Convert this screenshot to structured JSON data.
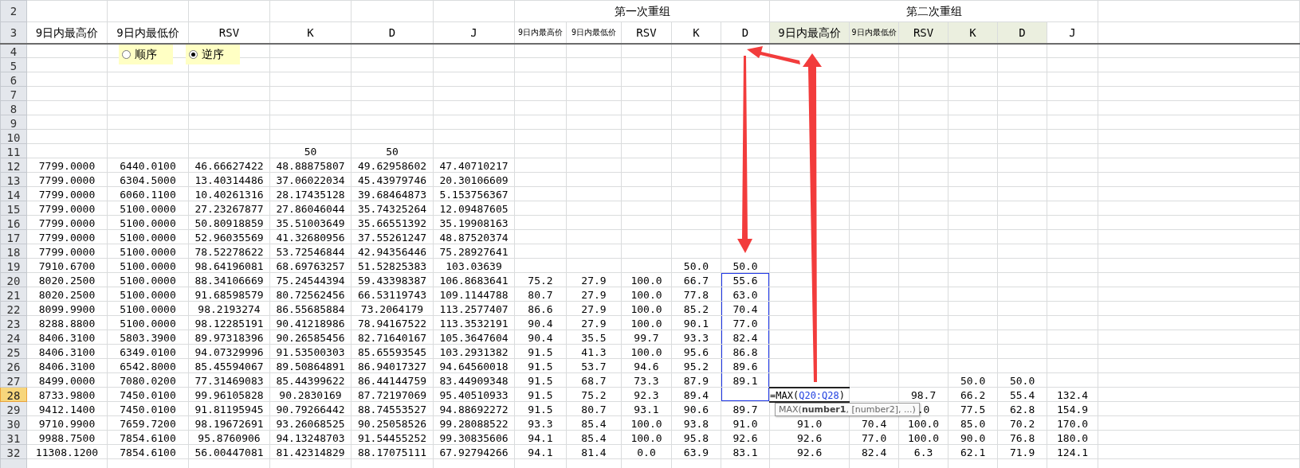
{
  "title_row": {
    "row": "2",
    "groups": [
      {
        "title": "第一次重组"
      },
      {
        "title": "第二次重组"
      }
    ]
  },
  "heading_row": {
    "row": "3",
    "columns": [
      {
        "label": "9日内最高价",
        "highlighted": false
      },
      {
        "label": "9日内最低价",
        "highlighted": false
      },
      {
        "label": "RSV",
        "highlighted": false
      },
      {
        "label": "K",
        "highlighted": false
      },
      {
        "label": "D",
        "highlighted": false
      },
      {
        "label": "J",
        "highlighted": false
      },
      {
        "label": "9日内最高价",
        "highlighted": false
      },
      {
        "label": "9日内最低价",
        "highlighted": false
      },
      {
        "label": "RSV",
        "highlighted": false
      },
      {
        "label": "K",
        "highlighted": false
      },
      {
        "label": "D",
        "highlighted": false
      },
      {
        "label": "9日内最高价",
        "highlighted": true
      },
      {
        "label": "9日内最低价",
        "highlighted": true
      },
      {
        "label": "RSV",
        "highlighted": true
      },
      {
        "label": "K",
        "highlighted": true
      },
      {
        "label": "D",
        "highlighted": true
      },
      {
        "label": "J",
        "highlighted": false
      }
    ]
  },
  "order_options": [
    {
      "label": "顺序",
      "selected": false
    },
    {
      "label": "逆序",
      "selected": true
    }
  ],
  "rows": [
    {
      "row": "4",
      "selected": false,
      "referenced": false
    },
    {
      "row": "5",
      "selected": false,
      "referenced": false
    },
    {
      "row": "6",
      "selected": false,
      "referenced": false
    },
    {
      "row": "7",
      "selected": false,
      "referenced": false
    },
    {
      "row": "8",
      "selected": false,
      "referenced": false
    },
    {
      "row": "9",
      "selected": false,
      "referenced": false
    },
    {
      "row": "10",
      "selected": false,
      "referenced": false
    },
    {
      "row": "11",
      "selected": false,
      "referenced": false,
      "cells": [
        null,
        null,
        null,
        "50",
        "50",
        null,
        null,
        null,
        null,
        null,
        null,
        null,
        null,
        null,
        null,
        null,
        null
      ]
    },
    {
      "row": "12",
      "selected": false,
      "referenced": false,
      "cells": [
        "7799.0000",
        "6440.0100",
        "46.66627422",
        "48.88875807",
        "49.62958602",
        "47.40710217",
        null,
        null,
        null,
        null,
        null,
        null,
        null,
        null,
        null,
        null,
        null
      ]
    },
    {
      "row": "13",
      "selected": false,
      "referenced": false,
      "cells": [
        "7799.0000",
        "6304.5000",
        "13.40314486",
        "37.06022034",
        "45.43979746",
        "20.30106609",
        null,
        null,
        null,
        null,
        null,
        null,
        null,
        null,
        null,
        null,
        null
      ]
    },
    {
      "row": "14",
      "selected": false,
      "referenced": false,
      "cells": [
        "7799.0000",
        "6060.1100",
        "10.40261316",
        "28.17435128",
        "39.68464873",
        "5.153756367",
        null,
        null,
        null,
        null,
        null,
        null,
        null,
        null,
        null,
        null,
        null
      ]
    },
    {
      "row": "15",
      "selected": false,
      "referenced": false,
      "cells": [
        "7799.0000",
        "5100.0000",
        "27.23267877",
        "27.86046044",
        "35.74325264",
        "12.09487605",
        null,
        null,
        null,
        null,
        null,
        null,
        null,
        null,
        null,
        null,
        null
      ]
    },
    {
      "row": "16",
      "selected": false,
      "referenced": false,
      "cells": [
        "7799.0000",
        "5100.0000",
        "50.80918859",
        "35.51003649",
        "35.66551392",
        "35.19908163",
        null,
        null,
        null,
        null,
        null,
        null,
        null,
        null,
        null,
        null,
        null
      ]
    },
    {
      "row": "17",
      "selected": false,
      "referenced": false,
      "cells": [
        "7799.0000",
        "5100.0000",
        "52.96035569",
        "41.32680956",
        "37.55261247",
        "48.87520374",
        null,
        null,
        null,
        null,
        null,
        null,
        null,
        null,
        null,
        null,
        null
      ]
    },
    {
      "row": "18",
      "selected": false,
      "referenced": false,
      "cells": [
        "7799.0000",
        "5100.0000",
        "78.52278622",
        "53.72546844",
        "42.94356446",
        "75.28927641",
        null,
        null,
        null,
        null,
        null,
        null,
        null,
        null,
        null,
        null,
        null
      ]
    },
    {
      "row": "19",
      "selected": false,
      "referenced": false,
      "cells": [
        "7910.6700",
        "5100.0000",
        "98.64196081",
        "68.69763257",
        "51.52825383",
        "103.03639",
        null,
        null,
        null,
        "50.0",
        "50.0",
        null,
        null,
        null,
        null,
        null,
        null
      ]
    },
    {
      "row": "20",
      "selected": false,
      "referenced": true,
      "cells": [
        "8020.2500",
        "5100.0000",
        "88.34106669",
        "75.24544394",
        "59.43398387",
        "106.8683641",
        "75.2",
        "27.9",
        "100.0",
        "66.7",
        "55.6",
        null,
        null,
        null,
        null,
        null,
        null
      ]
    },
    {
      "row": "21",
      "selected": false,
      "referenced": true,
      "cells": [
        "8020.2500",
        "5100.0000",
        "91.68598579",
        "80.72562456",
        "66.53119743",
        "109.1144788",
        "80.7",
        "27.9",
        "100.0",
        "77.8",
        "63.0",
        null,
        null,
        null,
        null,
        null,
        null
      ]
    },
    {
      "row": "22",
      "selected": false,
      "referenced": true,
      "cells": [
        "8099.9900",
        "5100.0000",
        "98.2193274",
        "86.55685884",
        "73.2064179",
        "113.2577407",
        "86.6",
        "27.9",
        "100.0",
        "85.2",
        "70.4",
        null,
        null,
        null,
        null,
        null,
        null
      ]
    },
    {
      "row": "23",
      "selected": false,
      "referenced": true,
      "cells": [
        "8288.8800",
        "5100.0000",
        "98.12285191",
        "90.41218986",
        "78.94167522",
        "113.3532191",
        "90.4",
        "27.9",
        "100.0",
        "90.1",
        "77.0",
        null,
        null,
        null,
        null,
        null,
        null
      ]
    },
    {
      "row": "24",
      "selected": false,
      "referenced": true,
      "cells": [
        "8406.3100",
        "5803.3900",
        "89.97318396",
        "90.26585456",
        "82.71640167",
        "105.3647604",
        "90.4",
        "35.5",
        "99.7",
        "93.3",
        "82.4",
        null,
        null,
        null,
        null,
        null,
        null
      ]
    },
    {
      "row": "25",
      "selected": false,
      "referenced": true,
      "cells": [
        "8406.3100",
        "6349.0100",
        "94.07329996",
        "91.53500303",
        "85.65593545",
        "103.2931382",
        "91.5",
        "41.3",
        "100.0",
        "95.6",
        "86.8",
        null,
        null,
        null,
        null,
        null,
        null
      ]
    },
    {
      "row": "26",
      "selected": false,
      "referenced": true,
      "cells": [
        "8406.3100",
        "6542.8000",
        "85.45594067",
        "89.50864891",
        "86.94017327",
        "94.64560018",
        "91.5",
        "53.7",
        "94.6",
        "95.2",
        "89.6",
        null,
        null,
        null,
        null,
        null,
        null
      ]
    },
    {
      "row": "27",
      "selected": false,
      "referenced": true,
      "cells": [
        "8499.0000",
        "7080.0200",
        "77.31469083",
        "85.44399622",
        "86.44144759",
        "83.44909348",
        "91.5",
        "68.7",
        "73.3",
        "87.9",
        "89.1",
        null,
        null,
        null,
        "50.0",
        "50.0",
        null
      ]
    },
    {
      "row": "28",
      "selected": true,
      "referenced": true,
      "cells": [
        "8733.9800",
        "7450.0100",
        "99.96105828",
        "90.2830169",
        "87.72197069",
        "95.40510933",
        "91.5",
        "75.2",
        "92.3",
        "89.4",
        null,
        {
          "kind": "formula",
          "prefix": "=MAX(",
          "reference": "Q20:Q28",
          "suffix": ")",
          "tooltip": "MAX(**number1**, [number2], ...)"
        },
        null,
        "98.7",
        "66.2",
        "55.4",
        "132.4"
      ]
    },
    {
      "row": "29",
      "selected": false,
      "referenced": false,
      "cells": [
        "9412.1400",
        "7450.0100",
        "91.81195945",
        "90.79266442",
        "88.74553527",
        "94.88692272",
        "91.5",
        "80.7",
        "93.1",
        "90.6",
        "89.7",
        null,
        null,
        ".0",
        "77.5",
        "62.8",
        "154.9"
      ]
    },
    {
      "row": "30",
      "selected": false,
      "referenced": false,
      "cells": [
        "9710.9900",
        "7659.7200",
        "98.19672691",
        "93.26068525",
        "90.25058526",
        "99.28088522",
        "93.3",
        "85.4",
        "100.0",
        "93.8",
        "91.0",
        "91.0",
        "70.4",
        "100.0",
        "85.0",
        "70.2",
        "170.0"
      ]
    },
    {
      "row": "31",
      "selected": false,
      "referenced": false,
      "cells": [
        "9988.7500",
        "7854.6100",
        "95.8760906",
        "94.13248703",
        "91.54455252",
        "99.30835606",
        "94.1",
        "85.4",
        "100.0",
        "95.8",
        "92.6",
        "92.6",
        "77.0",
        "100.0",
        "90.0",
        "76.8",
        "180.0"
      ]
    },
    {
      "row": "32",
      "selected": false,
      "referenced": false,
      "cells": [
        "11308.1200",
        "7854.6100",
        "56.00447081",
        "81.42314829",
        "88.17075111",
        "67.92794266",
        "94.1",
        "81.4",
        "0.0",
        "63.9",
        "83.1",
        "92.6",
        "82.4",
        "6.3",
        "62.1",
        "71.9",
        "124.1"
      ]
    }
  ]
}
